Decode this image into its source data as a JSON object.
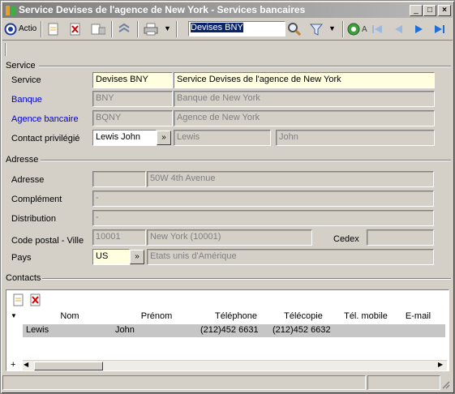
{
  "window": {
    "title": "Service Devises de l'agence de New York -  Services bancaires"
  },
  "toolbar": {
    "action_label": "Actio",
    "search_value": "Devises BNY",
    "nav_label": "A"
  },
  "service_section": {
    "header": "Service",
    "service_label": "Service",
    "service_code": "Devises BNY",
    "service_name": "Service Devises de l'agence de New York",
    "banque_label": "Banque",
    "banque_code": "BNY",
    "banque_name": "Banque de New York",
    "agence_label": "Agence bancaire",
    "agence_code": "BQNY",
    "agence_name": "Agence de New York",
    "contact_label": "Contact privilégié",
    "contact_value": "Lewis John",
    "contact_last": "Lewis",
    "contact_first": "John"
  },
  "address_section": {
    "header": "Adresse",
    "adresse_label": "Adresse",
    "adresse_value": "50W 4th Avenue",
    "complement_label": "Complément",
    "complement_value": "-",
    "distribution_label": "Distribution",
    "distribution_value": "-",
    "cp_label": "Code postal - Ville",
    "cp_value": "10001",
    "ville_value": "New York (10001)",
    "cedex_label": "Cedex",
    "pays_label": "Pays",
    "pays_code": "US",
    "pays_name": "Etats unis d'Amérique"
  },
  "contacts_section": {
    "header": "Contacts",
    "columns": [
      "Nom",
      "Prénom",
      "Téléphone",
      "Télécopie",
      "Tél. mobile",
      "E-mail"
    ],
    "rows": [
      {
        "nom": "Lewis",
        "prenom": "John",
        "telephone": "(212)452 6631",
        "telecopie": "(212)452 6632",
        "mobile": "",
        "email": ""
      }
    ],
    "add_row_symbol": "+"
  },
  "icons": [
    "app-icon",
    "minimize-icon",
    "maximize-icon",
    "close-icon",
    "action-icon",
    "new-icon",
    "delete-icon",
    "export-icon",
    "refresh-icon",
    "print-icon",
    "search-icon",
    "filter-icon",
    "first-icon",
    "prev-icon",
    "next-icon",
    "last-icon"
  ],
  "colors": {
    "editable_field": "#ffffe0",
    "link_label": "#0000cc",
    "selected_row": "#c6c6c6",
    "nav_arrow": "#1e6fd9"
  }
}
